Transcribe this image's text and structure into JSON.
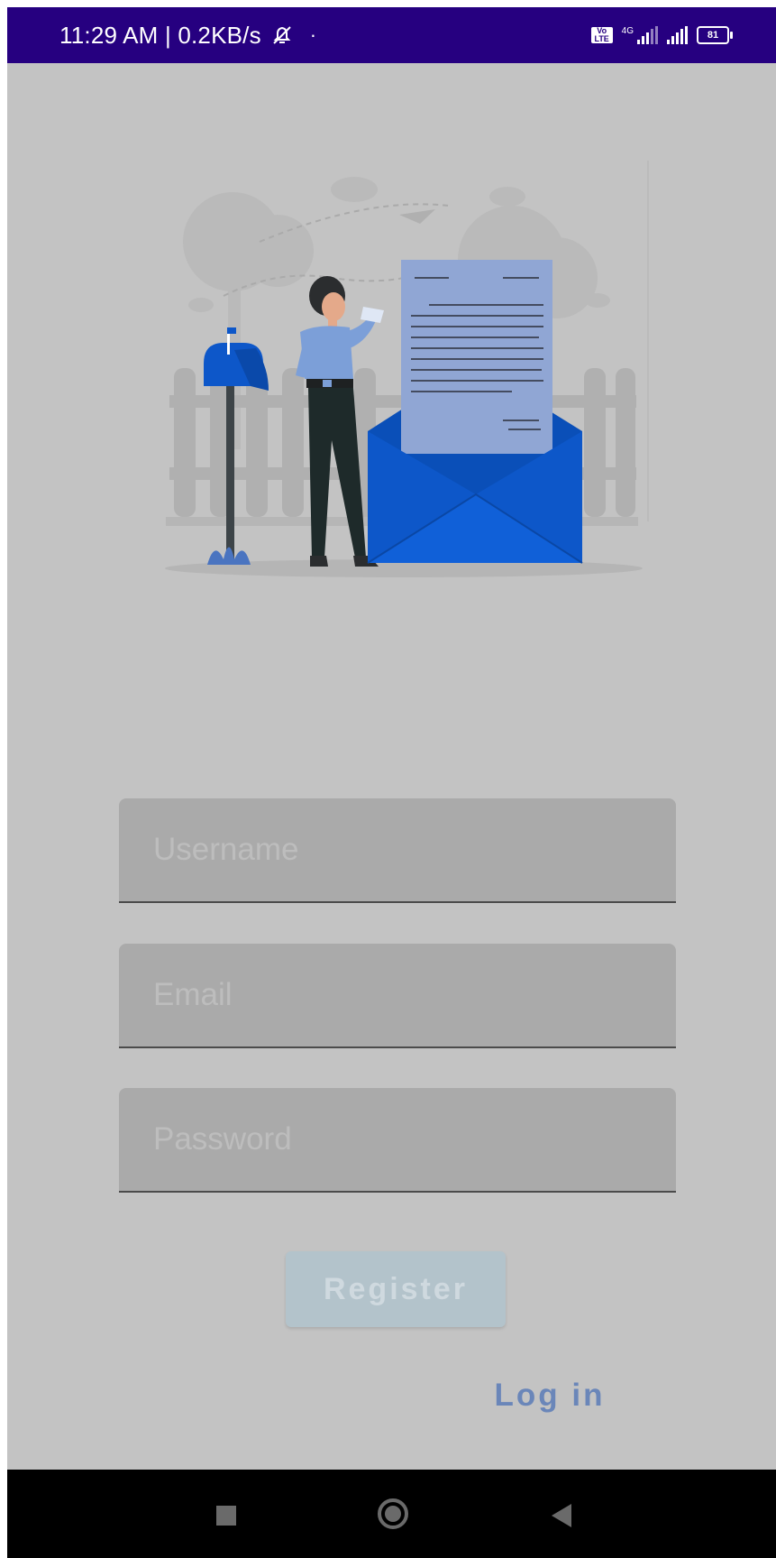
{
  "status_bar": {
    "time_speed": "11:29 AM | 0.2KB/s",
    "dot": "·",
    "volte": "Vo LTE",
    "network": "4G",
    "battery": "81"
  },
  "form": {
    "username_placeholder": "Username",
    "email_placeholder": "Email",
    "password_placeholder": "Password"
  },
  "register_label": "Register",
  "login_label": "Log in",
  "colors": {
    "status_bar": "#260080",
    "screen_overlay": "#c3c3c3",
    "field": "#aaaaaa",
    "button": "#b3c3cb",
    "link": "#6a86b9",
    "envelope": "#0d57c9"
  },
  "icons": [
    "mute-bell-icon",
    "signal-icon",
    "battery-icon",
    "recents-icon",
    "home-icon",
    "back-icon"
  ]
}
